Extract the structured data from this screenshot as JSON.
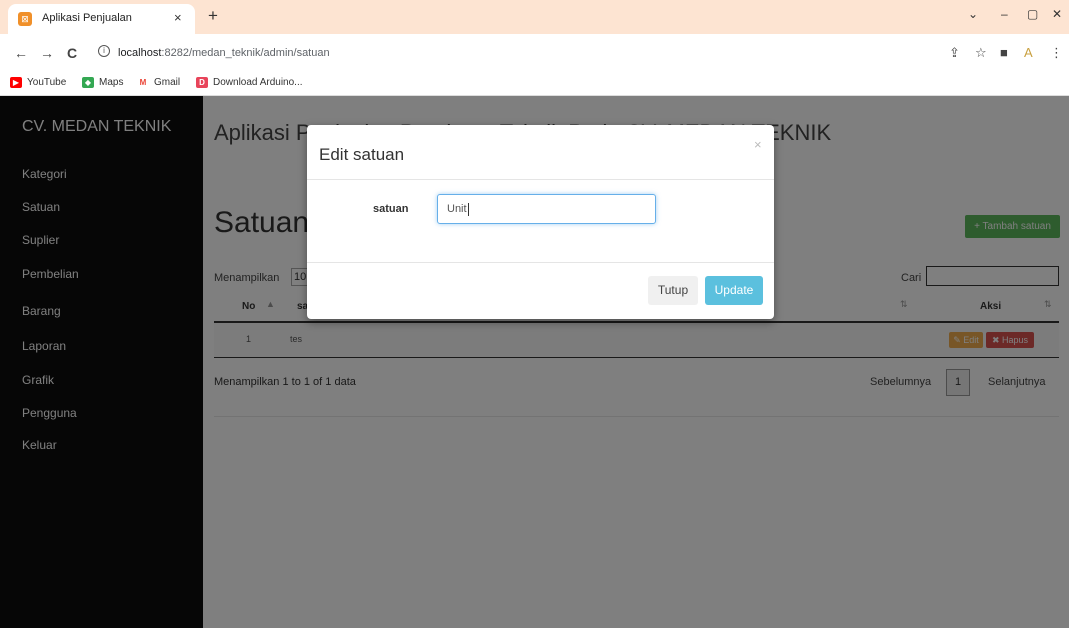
{
  "browser": {
    "tab": {
      "title": "Aplikasi Penjualan",
      "favicon": "app-icon",
      "close": "×"
    },
    "new_tab": "+",
    "window": {
      "chevron": "⌄",
      "minimize": "–",
      "restore": "▢",
      "close": "✕"
    },
    "nav": {
      "back": "←",
      "forward": "→",
      "reload": "C",
      "info": "i"
    },
    "url_host": "localhost",
    "url_path": ":8282/medan_teknik/admin/satuan",
    "addr_icons": {
      "share": "⇪",
      "star": "☆",
      "sidebar": "■",
      "extension": "A",
      "menu": "⋮"
    },
    "bookmarks": [
      {
        "label": "YouTube",
        "icon": "youtube-icon",
        "color": "#ff0000"
      },
      {
        "label": "Maps",
        "icon": "maps-icon",
        "color": "#34a853"
      },
      {
        "label": "Gmail",
        "icon": "gmail-icon",
        "color": "#ea4335"
      },
      {
        "label": "Download Arduino...",
        "icon": "d-icon",
        "color": "#e8445a"
      }
    ]
  },
  "sidebar": {
    "brand": "CV. MEDAN TEKNIK",
    "items": [
      {
        "label": "Kategori"
      },
      {
        "label": "Satuan"
      },
      {
        "label": "Suplier"
      },
      {
        "label": "Pembelian"
      },
      {
        "label": "Barang"
      },
      {
        "label": "Laporan"
      },
      {
        "label": "Grafik"
      },
      {
        "label": "Pengguna"
      },
      {
        "label": "Keluar"
      }
    ]
  },
  "main": {
    "header": "Aplikasi Penjualan Peralatan Teknik Pada CV. MEDAN TEKNIK",
    "title": "Satuan",
    "add_button": "Tambah satuan",
    "add_icon": "+",
    "show_label": "Menampilkan",
    "show_value": "10",
    "search_label": "Cari",
    "search_value": "",
    "table": {
      "columns": [
        "No",
        "satuan",
        "Aksi"
      ],
      "rows": [
        {
          "no": "1",
          "satuan": "tes"
        }
      ],
      "edit_label": "Edit",
      "delete_label": "Hapus",
      "edit_icon": "✎",
      "delete_icon": "✖"
    },
    "info": "Menampilkan 1 to 1 of 1 data",
    "pagination": {
      "prev": "Sebelumnya",
      "page": "1",
      "next": "Selanjutnya"
    }
  },
  "modal": {
    "title": "Edit satuan",
    "close": "×",
    "field_label": "satuan",
    "field_value": "Unit",
    "btn_close": "Tutup",
    "btn_update": "Update"
  },
  "colors": {
    "sidebar_bg": "#0d0d0d",
    "success": "#5cb85c",
    "warning": "#f0ad4e",
    "danger": "#d9534f",
    "info": "#5bc0de",
    "tabbar_bg": "#fde4d2"
  }
}
